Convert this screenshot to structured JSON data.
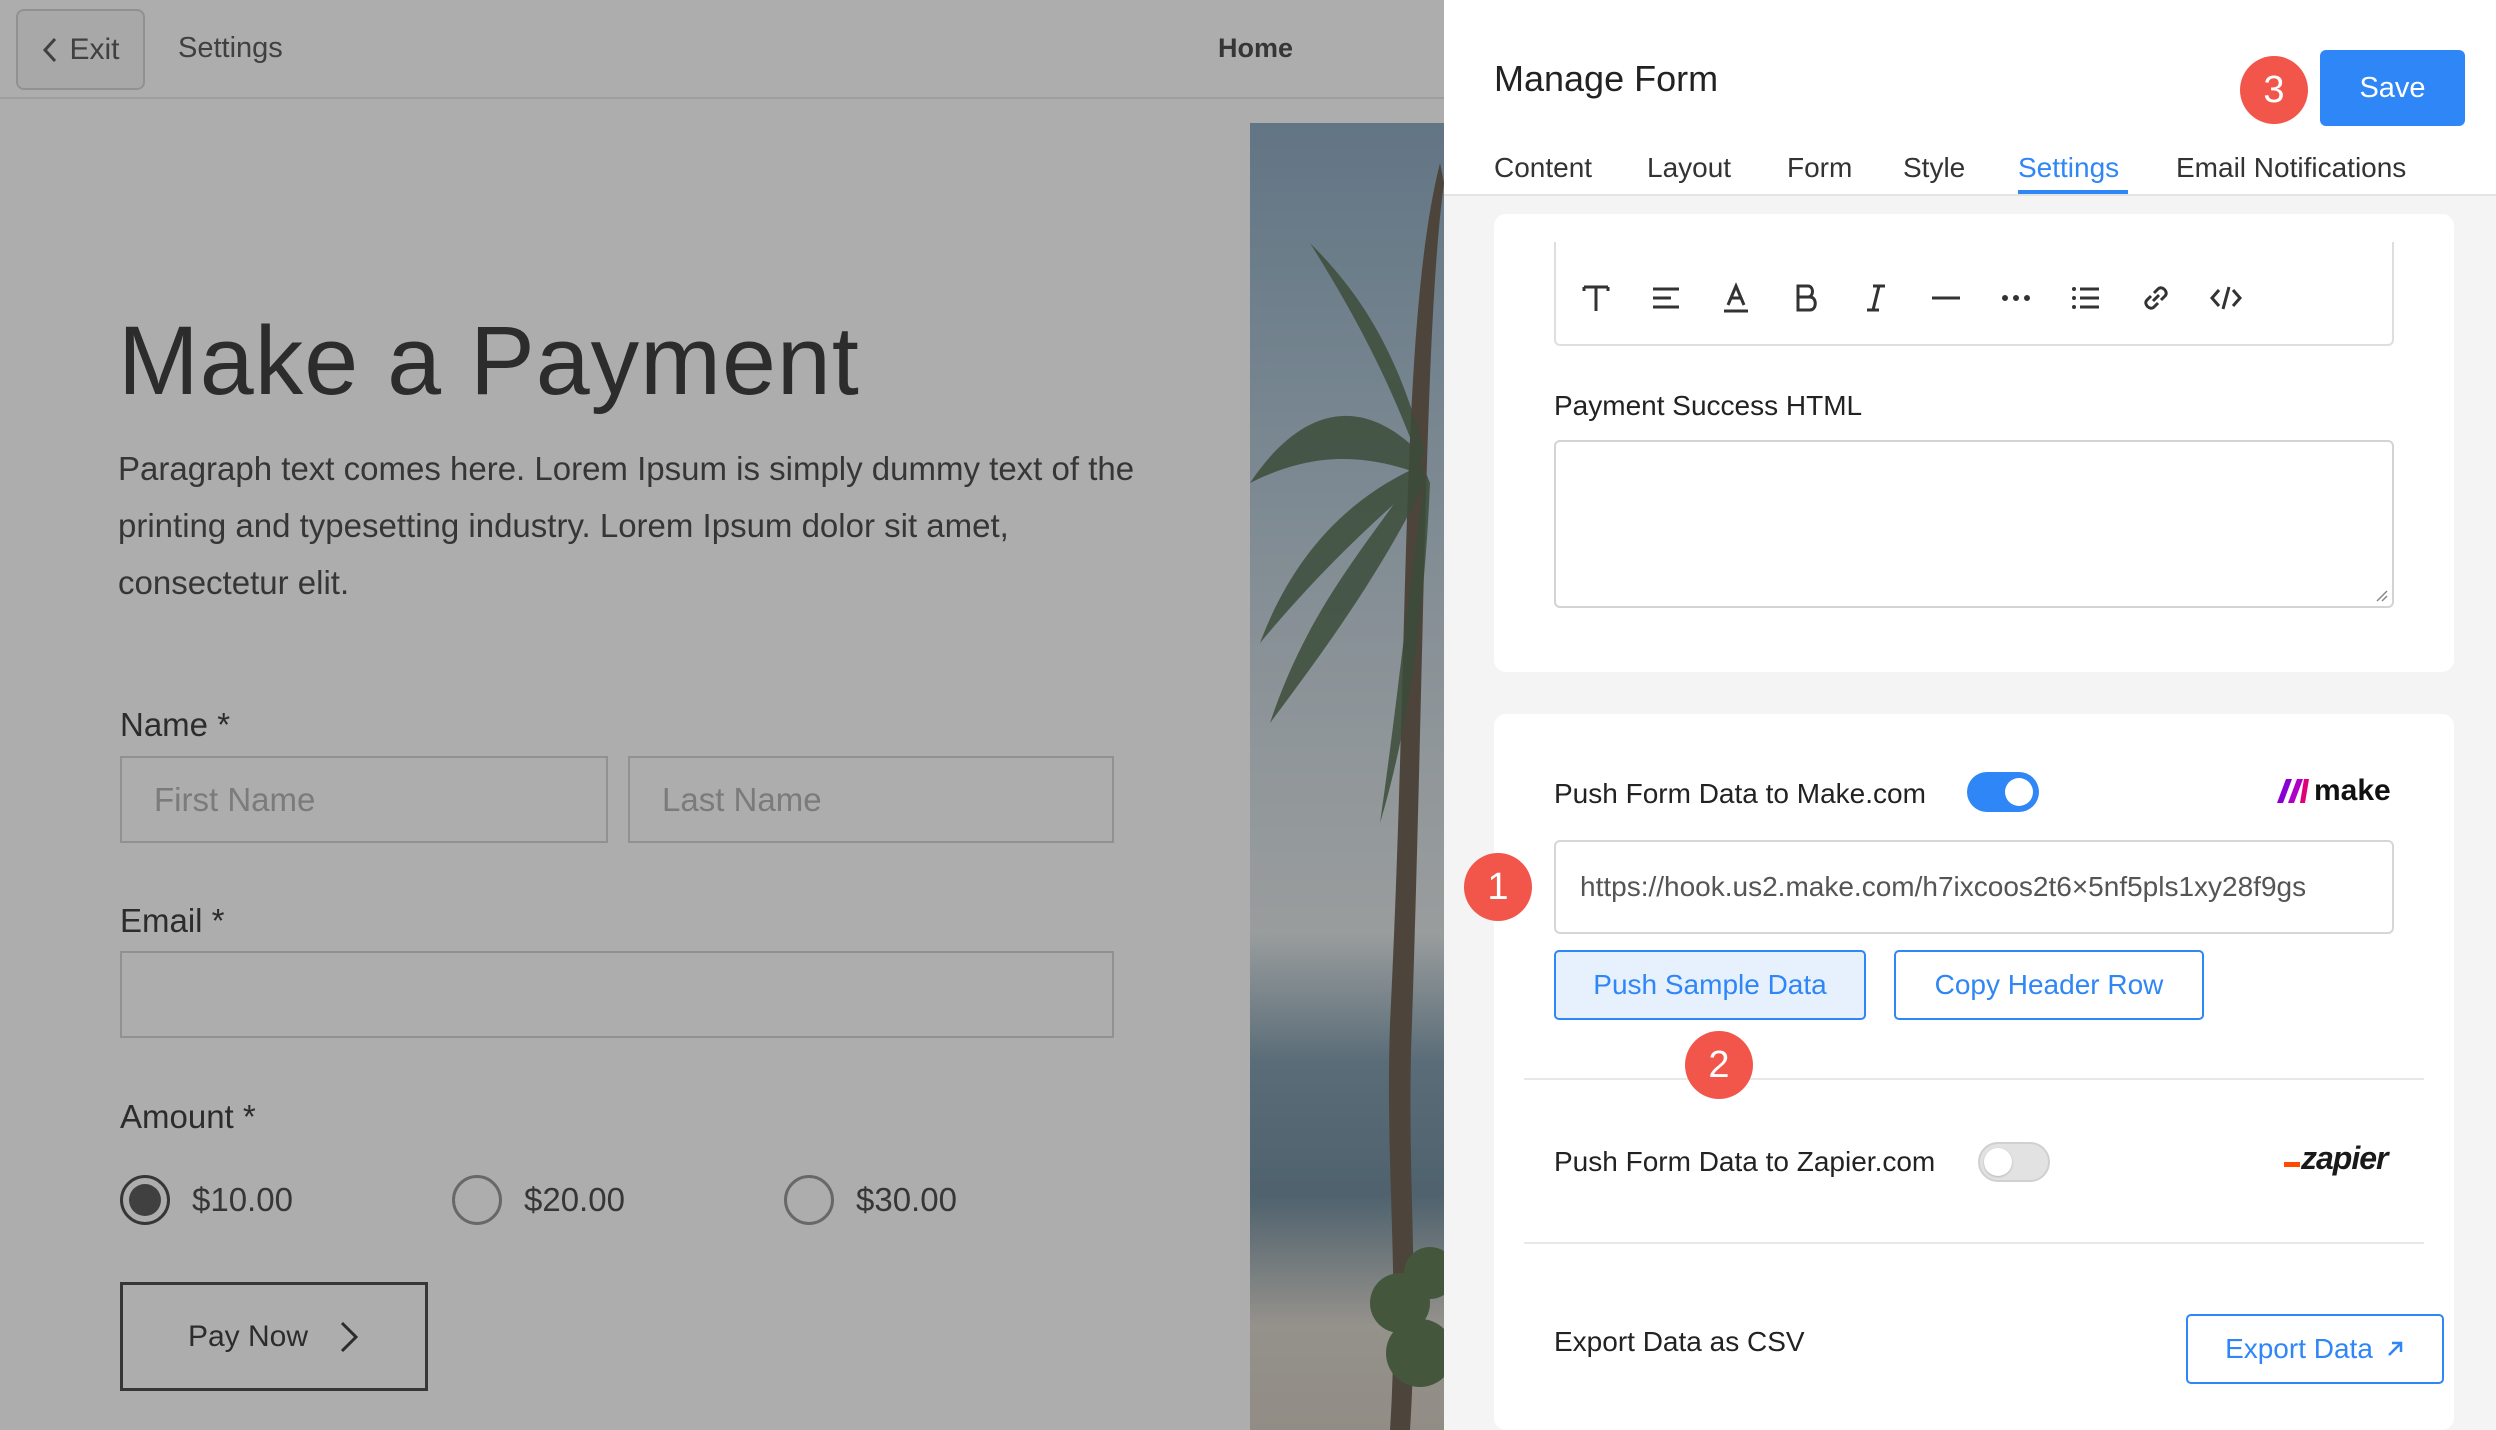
{
  "topbar": {
    "exit_label": "Exit",
    "settings_label": "Settings",
    "home_label": "Home"
  },
  "payment_form": {
    "title": "Make a Payment",
    "paragraph": "Paragraph text comes here. Lorem Ipsum is simply dummy text of the printing and typesetting industry. Lorem Ipsum dolor sit amet, consectetur elit.",
    "name_label": "Name *",
    "first_name_placeholder": "First Name",
    "last_name_placeholder": "Last Name",
    "email_label": "Email *",
    "amount_label": "Amount *",
    "amounts": [
      {
        "label": "$10.00",
        "selected": true
      },
      {
        "label": "$20.00",
        "selected": false
      },
      {
        "label": "$30.00",
        "selected": false
      }
    ],
    "pay_button": "Pay Now"
  },
  "panel": {
    "title": "Manage Form",
    "save_label": "Save",
    "tabs": [
      "Content",
      "Layout",
      "Form",
      "Style",
      "Settings",
      "Email Notifications"
    ],
    "active_tab": "Settings",
    "toolbar_icons": [
      "text-icon",
      "align-icon",
      "text-color-icon",
      "bold-icon",
      "italic-icon",
      "horizontal-rule-icon",
      "more-icon",
      "list-icon",
      "link-icon",
      "code-icon"
    ],
    "payment_success_label": "Payment Success HTML",
    "make": {
      "label": "Push Form Data to Make.com",
      "enabled": true,
      "logo_text": "make",
      "webhook_url": "https://hook.us2.make.com/h7ixcoos2t6×5nf5pls1xy28f9gs",
      "push_sample": "Push Sample Data",
      "copy_header": "Copy Header Row"
    },
    "zapier": {
      "label": "Push Form Data to Zapier.com",
      "enabled": false,
      "logo_text": "zapier"
    },
    "export": {
      "label": "Export Data as CSV",
      "button": "Export Data"
    }
  },
  "markers": [
    "1",
    "2",
    "3"
  ],
  "colors": {
    "accent": "#2f86f6",
    "marker": "#f2564b",
    "make_brand": "#6d00cc",
    "zapier_brand": "#ff4a00"
  }
}
